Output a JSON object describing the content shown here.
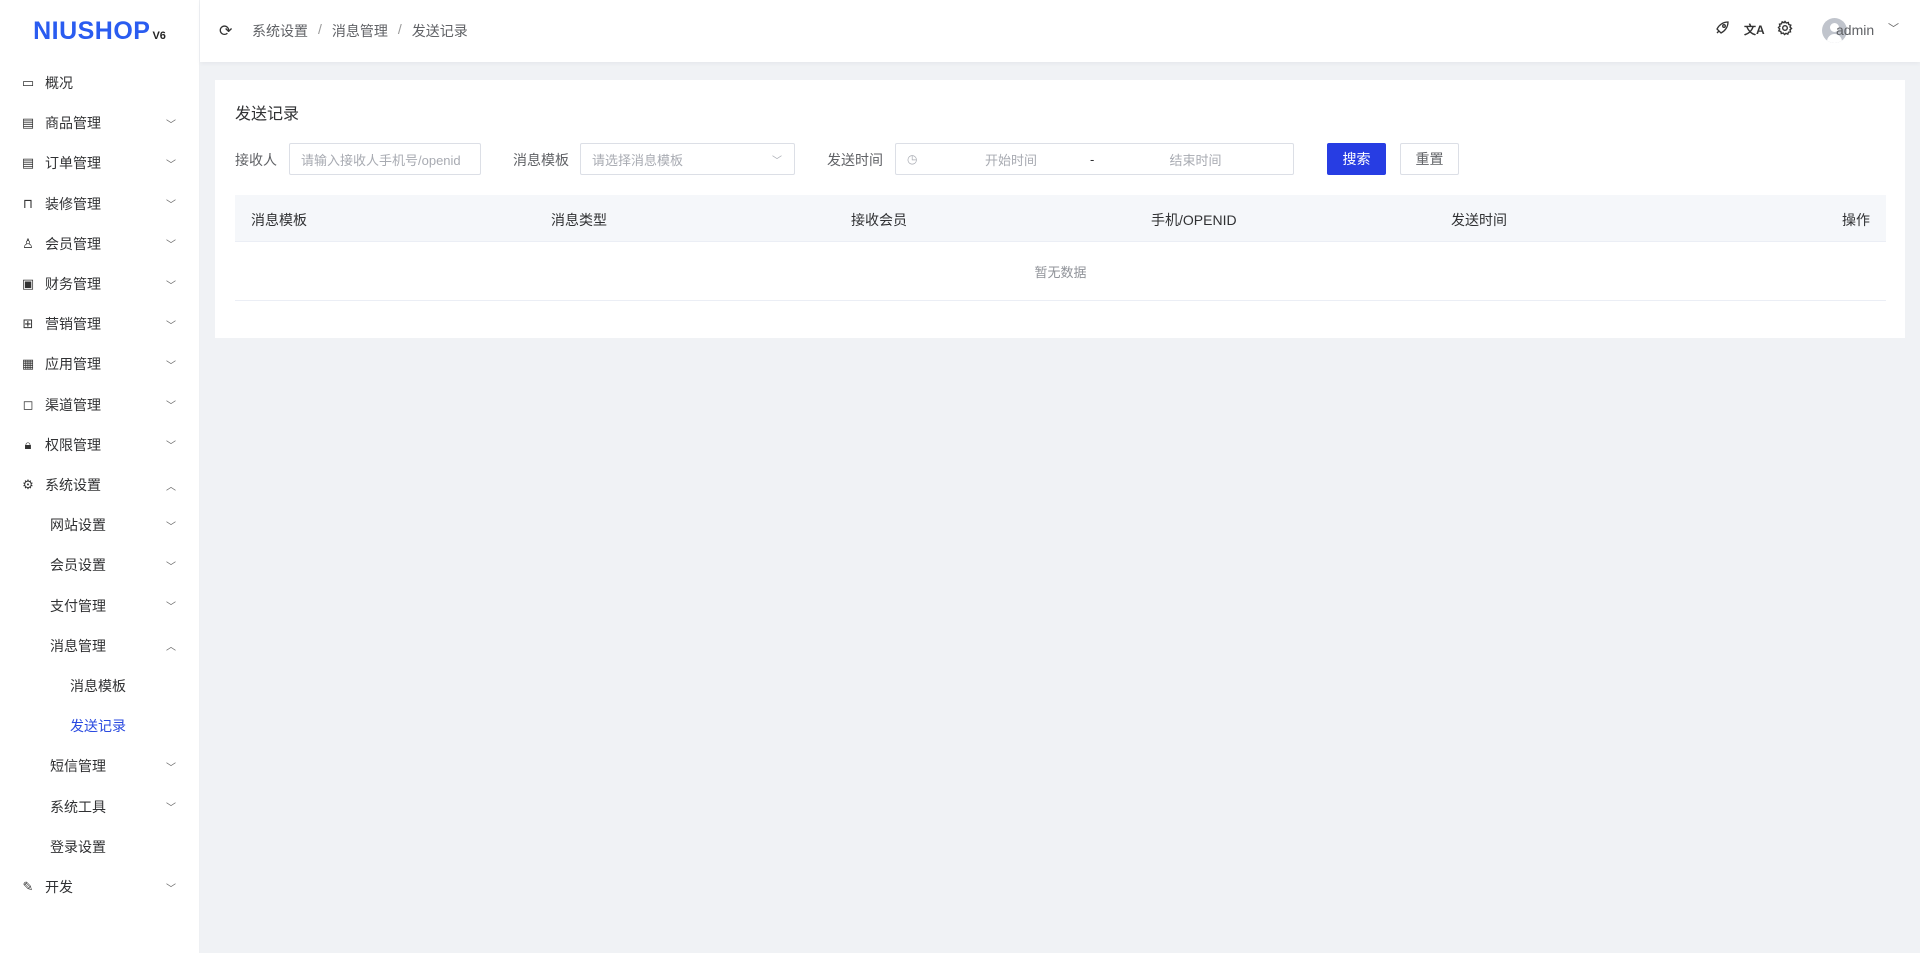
{
  "logo": {
    "text": "NIUSHOP",
    "version": "V6"
  },
  "sidebar": {
    "items": [
      {
        "label": "概况",
        "icon": "chart-monitor-icon",
        "level": 1,
        "chevron": ""
      },
      {
        "label": "商品管理",
        "icon": "goods-icon",
        "level": 1,
        "chevron": "down"
      },
      {
        "label": "订单管理",
        "icon": "order-icon",
        "level": 1,
        "chevron": "down"
      },
      {
        "label": "装修管理",
        "icon": "decorate-icon",
        "level": 1,
        "chevron": "down"
      },
      {
        "label": "会员管理",
        "icon": "member-icon",
        "level": 1,
        "chevron": "down"
      },
      {
        "label": "财务管理",
        "icon": "finance-icon",
        "level": 1,
        "chevron": "down"
      },
      {
        "label": "营销管理",
        "icon": "gift-icon",
        "level": 1,
        "chevron": "down"
      },
      {
        "label": "应用管理",
        "icon": "apps-icon",
        "level": 1,
        "chevron": "down"
      },
      {
        "label": "渠道管理",
        "icon": "channel-icon",
        "level": 1,
        "chevron": "down"
      },
      {
        "label": "权限管理",
        "icon": "lock-icon",
        "level": 1,
        "chevron": "down"
      },
      {
        "label": "系统设置",
        "icon": "gear-icon",
        "level": 1,
        "chevron": "up"
      },
      {
        "label": "网站设置",
        "level": 2,
        "chevron": "down"
      },
      {
        "label": "会员设置",
        "level": 2,
        "chevron": "down"
      },
      {
        "label": "支付管理",
        "level": 2,
        "chevron": "down"
      },
      {
        "label": "消息管理",
        "level": 2,
        "chevron": "up"
      },
      {
        "label": "消息模板",
        "level": 3,
        "chevron": ""
      },
      {
        "label": "发送记录",
        "level": 3,
        "chevron": "",
        "active": true
      },
      {
        "label": "短信管理",
        "level": 2,
        "chevron": "down"
      },
      {
        "label": "系统工具",
        "level": 2,
        "chevron": "down"
      },
      {
        "label": "登录设置",
        "level": 2,
        "chevron": ""
      },
      {
        "label": "开发",
        "icon": "edit-icon",
        "level": 1,
        "chevron": "down"
      }
    ]
  },
  "header": {
    "breadcrumb": [
      "系统设置",
      "消息管理",
      "发送记录"
    ],
    "separator": "/",
    "user": "admin"
  },
  "page": {
    "title": "发送记录",
    "filters": {
      "receiver_label": "接收人",
      "receiver_placeholder": "请输入接收人手机号/openid",
      "template_label": "消息模板",
      "template_placeholder": "请选择消息模板",
      "time_label": "发送时间",
      "start_placeholder": "开始时间",
      "range_sep": "-",
      "end_placeholder": "结束时间",
      "search": "搜索",
      "reset": "重置"
    },
    "table": {
      "columns": [
        "消息模板",
        "消息类型",
        "接收会员",
        "手机/OPENID",
        "发送时间",
        "操作"
      ],
      "empty": "暂无数据"
    }
  },
  "colors": {
    "primary": "#273de3",
    "active": "#2a4ae0"
  }
}
